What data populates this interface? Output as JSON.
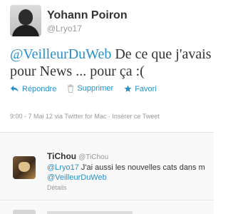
{
  "tweet": {
    "author_name": "Yohann Poiron",
    "author_handle": "@Lryo17",
    "text_mention": "@VeilleurDuWeb",
    "text_line1_rest": " De ce que j'avais",
    "text_line2": "pour News ... pour ça :(",
    "actions": {
      "reply": "Répondre",
      "delete": "Supprimer",
      "favorite": "Favori"
    },
    "meta": "9:00 - 7 Mai 12 via Twitter for Mac · Insérer ce Tweet"
  },
  "reply": {
    "author_name": "TiChou",
    "author_handle": "@TiChou",
    "mention_1": "@Lryo17",
    "text_line1_rest": " J'ai aussi les nouvelles cats dans m",
    "mention_2": "@VeilleurDuWeb",
    "details": "Détails"
  },
  "colors": {
    "link": "#2a8fc7",
    "muted": "#999999",
    "text": "#333333"
  },
  "icons": {
    "reply": "reply-arrow-icon",
    "delete": "trash-icon",
    "favorite": "star-icon"
  }
}
